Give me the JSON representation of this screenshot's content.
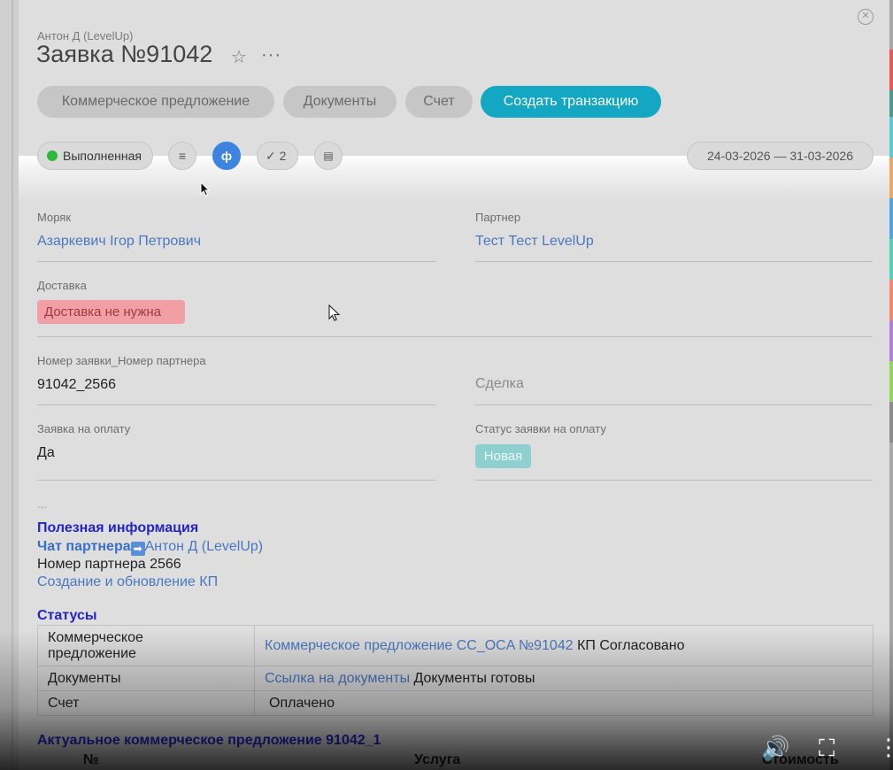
{
  "header": {
    "owner": "Антон Д (LevelUp)",
    "title": "Заявка №91042",
    "close_symbol": "✕",
    "star_symbol": "☆",
    "more_symbol": "···"
  },
  "actions": {
    "commercial_offer": "Коммерческое предложение",
    "documents": "Документы",
    "invoice": "Счет",
    "create_transaction": "Создать транзакцию"
  },
  "toolbar": {
    "status": "Выполненная",
    "tasks_count": "2",
    "date_range": "24-03-2026 — 31-03-2026",
    "list_icon": "≡",
    "currency_icon": "ф",
    "check_icon": "✓",
    "comment_icon": "▤"
  },
  "fields": {
    "sailor_label": "Моряк",
    "sailor_value": "Азаркевич Ігор Петрович",
    "partner_label": "Партнер",
    "partner_value": "Тест Тест LevelUp",
    "delivery_label": "Доставка",
    "delivery_value": "Доставка не нужна",
    "order_partner_label": "Номер заявки_Номер партнера",
    "order_partner_value": "91042_2566",
    "deal_label": "Сделка",
    "payment_request_label": "Заявка на оплату",
    "payment_request_value": "Да",
    "payment_status_label": "Статус заявки на оплату",
    "payment_status_value": "Новая"
  },
  "info": {
    "ellipsis": "...",
    "heading": "Полезная информация",
    "partner_chat_label": "Чат партнера",
    "arrow_symbol": "➡",
    "partner_chat_link": "Антон Д (LevelUp)",
    "partner_number": "Номер партнера 2566",
    "create_update_link": "Создание и обновление КП"
  },
  "statuses": {
    "heading": "Статусы",
    "rows": [
      {
        "name_line1": "Коммерческое",
        "name_line2": "предложение",
        "link": "Коммерческое предложение CC_OCA №91042",
        "status": " КП Согласовано"
      },
      {
        "name": "Документы",
        "link": "Ссылка на документы",
        "status": " Документы готовы"
      },
      {
        "name": "Счет",
        "status": "Оплачено"
      }
    ]
  },
  "offer": {
    "heading": "Актуальное коммерческое предложение 91042_1",
    "col_num": "№",
    "col_service": "Услуга",
    "col_cost": "Стоимость"
  },
  "video": {
    "volume_icon": "🔊",
    "fullscreen_icon": "⛶",
    "menu_icon": "⋮"
  },
  "colors": {
    "accent": "#14a7c4",
    "active_chip": "#3d84e0",
    "status_green": "#2db83d",
    "delivery_tag": "#f19ea4",
    "payment_status_tag": "#8ecfd0",
    "link": "#4a78c0",
    "heading_blue": "#2424c8"
  }
}
